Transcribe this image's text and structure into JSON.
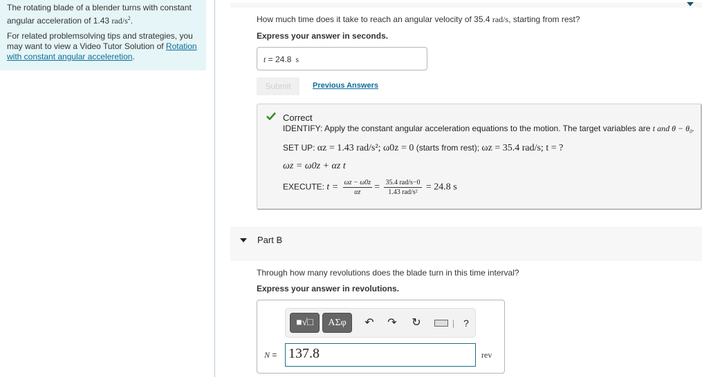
{
  "info_panel": {
    "problem_text": "The rotating blade of a blender turns with constant angular acceleration of 1.43 ",
    "problem_unit": "rad/s",
    "problem_unit_exp": "2",
    "problem_end": ".",
    "tips_text": "For related problemsolving tips and strategies, you may want to view a Video Tutor Solution of ",
    "tips_link": "Rotation with constant angular acceleretion",
    "tips_end": "."
  },
  "part_a": {
    "question": "How much time does it take to reach an angular velocity of 35.4 ",
    "question_unit": "rad/s",
    "question_end": ", starting from rest?",
    "instruction": "Express your answer in seconds.",
    "answer_var": "t",
    "answer_eq": " =  ",
    "answer_value": "24.8",
    "answer_unit": "s",
    "submit_label": "Submit",
    "previous_answers_label": "Previous Answers"
  },
  "feedback": {
    "status": "Correct",
    "identify": "IDENTIFY: Apply the constant angular acceleration equations to the motion. The target variables are ",
    "identify_vars": "t and θ − θ₀.",
    "setup_label": "SET UP: ",
    "setup_alpha": "αz = 1.43 rad/s²",
    "setup_omega0": "; ω0z = 0",
    "setup_rest": " (starts from rest); ",
    "setup_omega": "ωz = 35.4 rad/s; t = ?",
    "equation": "ωz = ω0z + αz t",
    "execute_label": "EXECUTE: ",
    "execute_t": "t =",
    "frac1_num": "ωz − ω0z",
    "frac1_den": "αz",
    "frac2_num": "35.4 rad/s−0",
    "frac2_den": "1.43 rad/s²",
    "result": "= 24.8 s"
  },
  "part_b": {
    "header": "Part B",
    "question": "Through how many revolutions does the blade turn in this time interval?",
    "instruction": "Express your answer in revolutions.",
    "toolbar": {
      "template_button": "■√□",
      "greek_button": "ΑΣφ",
      "undo_icon": "↶",
      "redo_icon": "↷",
      "reset_icon": "↻",
      "help_label": "?"
    },
    "answer_var": "N",
    "answer_eq": " =",
    "answer_value": "137.8",
    "answer_unit": "rev"
  }
}
